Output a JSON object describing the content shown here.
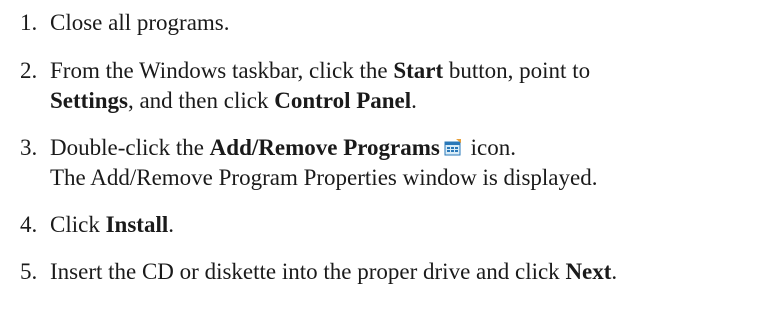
{
  "steps": [
    {
      "number": "1.",
      "text": "Close all programs."
    },
    {
      "number": "2.",
      "line1_prefix": "From the Windows taskbar, click the ",
      "line1_bold": "Start",
      "line1_suffix": " button, point to",
      "line2_bold1": "Settings",
      "line2_mid": ", and then click ",
      "line2_bold2": "Control Panel",
      "line2_end": "."
    },
    {
      "number": "3.",
      "line1_prefix": "Double-click the ",
      "line1_bold": "Add/Remove Programs",
      "icon": "add-remove-programs-icon",
      "line1_suffix": " icon.",
      "line2": "The Add/Remove Program Properties window is displayed."
    },
    {
      "number": "4.",
      "prefix": "Click ",
      "bold": "Install",
      "suffix": "."
    },
    {
      "number": "5.",
      "prefix": "Insert the CD or diskette into the proper drive and click ",
      "bold": "Next",
      "suffix": "."
    }
  ]
}
